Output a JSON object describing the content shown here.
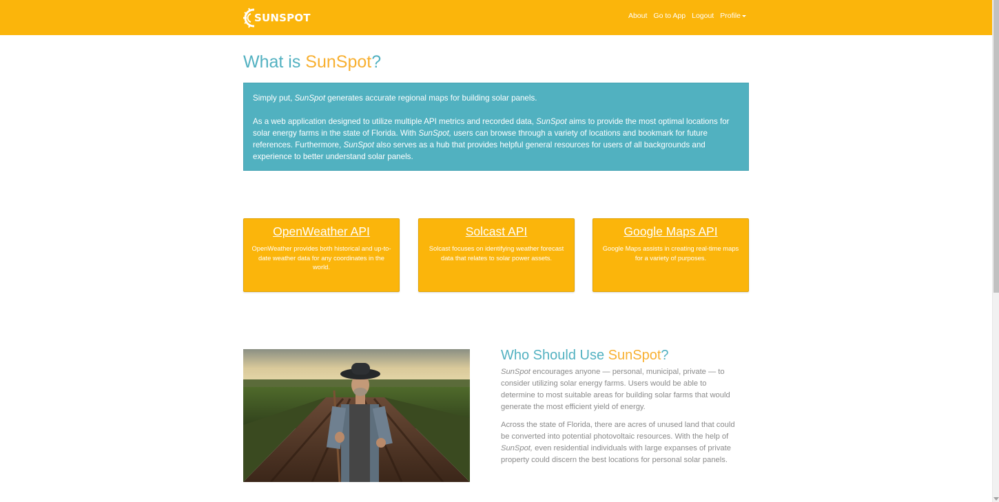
{
  "brand": {
    "name": "SUNSPOT"
  },
  "nav": {
    "about": "About",
    "go_to_app": "Go to App",
    "logout": "Logout",
    "profile": "Profile"
  },
  "title": {
    "prefix": "What is ",
    "accent": "SunSpot",
    "suffix": "?"
  },
  "intro": {
    "p1_a": "Simply put, ",
    "p1_em": "SunSpot",
    "p1_b": " generates accurate regional maps for building solar panels.",
    "p2_a": "As a web application designed to utilize multiple API metrics and recorded data, ",
    "p2_em1": "SunSpot",
    "p2_b": " aims to provide the most optimal locations for solar energy farms in the state of Florida. With ",
    "p2_em2": "SunSpot,",
    "p2_c": " users can browse through a variety of locations and bookmark for future references. Furthermore, ",
    "p2_em3": "SunSpot",
    "p2_d": " also serves as a hub that provides helpful general resources for users of all backgrounds and experience to better understand solar panels."
  },
  "apis": [
    {
      "title": "OpenWeather API",
      "desc": "OpenWeather provides both historical and up-to-date weather data for any coordinates in the world."
    },
    {
      "title": "Solcast API",
      "desc": "Solcast focuses on identifying weather forecast data that relates to solar power assets."
    },
    {
      "title": "Google Maps API",
      "desc": "Google Maps assists in creating real-time maps for a variety of purposes."
    }
  ],
  "who": {
    "title_prefix": "Who Should Use ",
    "title_accent": "SunSpot",
    "title_suffix": "?",
    "p1_em": "SunSpot",
    "p1_text": " encourages anyone — personal, municipal, private — to consider utilizing solar energy farms. Users would be able to determine to most suitable areas for building solar farms that would generate the most efficient yield of energy.",
    "p2_a": "Across the state of Florida, there are acres of unused land that could be converted into potential photovoltaic resources. With the help of ",
    "p2_em": "SunSpot,",
    "p2_b": " even residential individuals with large expanses of private property could discern the best locations for personal solar panels."
  },
  "colors": {
    "navbar": "#fbb50b",
    "teal": "#52b1c1",
    "accent": "#f8b031"
  }
}
